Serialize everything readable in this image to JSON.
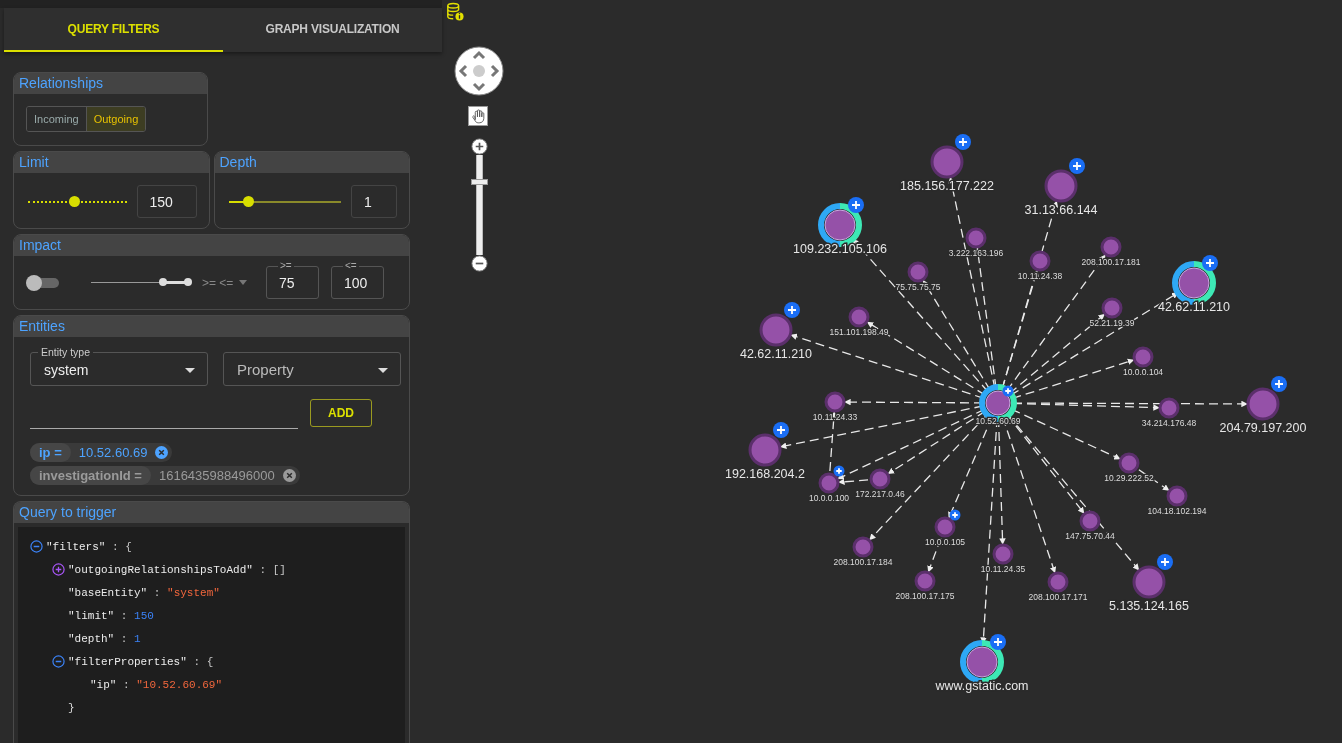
{
  "tabs": [
    {
      "label": "QUERY FILTERS",
      "selected": true
    },
    {
      "label": "GRAPH VISUALIZATION",
      "selected": false
    }
  ],
  "relationships": {
    "title": "Relationships",
    "options": [
      {
        "label": "Incoming",
        "selected": false
      },
      {
        "label": "Outgoing",
        "selected": true
      }
    ]
  },
  "limit": {
    "title": "Limit",
    "level": 0.48,
    "value": "150"
  },
  "depth": {
    "title": "Depth",
    "level": 0.18,
    "value": "1"
  },
  "impact": {
    "title": "Impact",
    "enabled": false,
    "range": [
      {
        "level": 0.74
      },
      {
        "level": 1
      }
    ],
    "operator": ">= <=",
    "min": {
      "label": ">=",
      "value": "75"
    },
    "max": {
      "label": "<=",
      "value": "100"
    }
  },
  "entities": {
    "title": "Entities",
    "entity_type": {
      "label": "Entity type",
      "value": "system"
    },
    "property": {
      "placeholder": "Property"
    },
    "add_button": "ADD",
    "chips": [
      {
        "key": "ip =",
        "value": "10.52.60.69",
        "color": "#4da3ff"
      },
      {
        "key": "investigationId =",
        "value": "1616435988496000",
        "color": "#9a9a9a"
      }
    ]
  },
  "query": {
    "title": "Query to trigger",
    "tree": [
      {
        "expanded": true,
        "parts": [
          {
            "text": "\"filters\"",
            "kind": "key"
          },
          {
            "text": " : {",
            "kind": "punct"
          }
        ],
        "children": [
          {
            "expanded": false,
            "parts": [
              {
                "text": "\"outgoingRelationshipsToAdd\"",
                "kind": "key"
              },
              {
                "text": " : []",
                "kind": "punct"
              }
            ]
          },
          {
            "parts": [
              {
                "text": "\"baseEntity\"",
                "kind": "key"
              },
              {
                "text": " : ",
                "kind": "punct"
              },
              {
                "text": "\"system\"",
                "kind": "string"
              }
            ]
          },
          {
            "parts": [
              {
                "text": "\"limit\"",
                "kind": "key"
              },
              {
                "text": " : ",
                "kind": "punct"
              },
              {
                "text": "150",
                "kind": "number"
              }
            ]
          },
          {
            "parts": [
              {
                "text": "\"depth\"",
                "kind": "key"
              },
              {
                "text": " : ",
                "kind": "punct"
              },
              {
                "text": "1",
                "kind": "number"
              }
            ]
          },
          {
            "expanded": true,
            "parts": [
              {
                "text": "\"filterProperties\"",
                "kind": "key"
              },
              {
                "text": " : {",
                "kind": "punct"
              }
            ],
            "closing": "}",
            "children": [
              {
                "parts": [
                  {
                    "text": "\"ip\"",
                    "kind": "key"
                  },
                  {
                    "text": " : ",
                    "kind": "punct"
                  },
                  {
                    "text": "\"10.52.60.69\"",
                    "kind": "string"
                  }
                ]
              }
            ]
          }
        ]
      }
    ]
  },
  "graph_controls": {
    "zoom": {
      "level": 0.73
    }
  },
  "graph": {
    "nodes": [
      {
        "label": "185.156.177.222",
        "kind": "large",
        "ring": false,
        "badge": true
      },
      {
        "label": "31.13.66.144",
        "kind": "large",
        "ring": false,
        "badge": true
      },
      {
        "label": "109.232.105.106",
        "kind": "large",
        "ring": true,
        "badge": true
      },
      {
        "label": "3.222.163.196",
        "kind": "small",
        "ring": false,
        "badge": false
      },
      {
        "label": "208.100.17.181",
        "kind": "small",
        "ring": false,
        "badge": false
      },
      {
        "label": "10.11.24.38",
        "kind": "small",
        "ring": false,
        "badge": false
      },
      {
        "label": "75.75.75.75",
        "kind": "small",
        "ring": false,
        "badge": false
      },
      {
        "label": "42.62.11.210",
        "kind": "large",
        "ring": true,
        "badge": true
      },
      {
        "label": "52.21.19.39",
        "kind": "small",
        "ring": false,
        "badge": false
      },
      {
        "label": "151.101.198.49",
        "kind": "small",
        "ring": false,
        "badge": false
      },
      {
        "label": "42.62.11.210",
        "kind": "large",
        "ring": false,
        "badge": true
      },
      {
        "label": "10.0.0.104",
        "kind": "small",
        "ring": false,
        "badge": false
      },
      {
        "label": "10.11.24.33",
        "kind": "small",
        "ring": false,
        "badge": false
      },
      {
        "label": "10.52.60.69",
        "kind": "hub",
        "ring": true,
        "badge": true
      },
      {
        "label": "204.79.197.200",
        "kind": "large",
        "ring": false,
        "badge": true
      },
      {
        "label": "34.214.176.48",
        "kind": "small",
        "ring": false,
        "badge": false
      },
      {
        "label": "192.168.204.2",
        "kind": "large",
        "ring": false,
        "badge": true
      },
      {
        "label": "10.29.222.52",
        "kind": "small",
        "ring": false,
        "badge": false
      },
      {
        "label": "172.217.0.46",
        "kind": "small",
        "ring": false,
        "badge": false
      },
      {
        "label": "10.0.0.100",
        "kind": "small",
        "ring": false,
        "badge": true
      },
      {
        "label": "104.18.102.194",
        "kind": "small",
        "ring": false,
        "badge": false
      },
      {
        "label": "147.75.70.44",
        "kind": "small",
        "ring": false,
        "badge": false
      },
      {
        "label": "10.0.0.105",
        "kind": "small",
        "ring": false,
        "badge": true
      },
      {
        "label": "208.100.17.184",
        "kind": "small",
        "ring": false,
        "badge": false
      },
      {
        "label": "10.11.24.35",
        "kind": "small",
        "ring": false,
        "badge": false
      },
      {
        "label": "208.100.17.175",
        "kind": "small",
        "ring": false,
        "badge": false
      },
      {
        "label": "208.100.17.171",
        "kind": "small",
        "ring": false,
        "badge": false
      },
      {
        "label": "5.135.124.165",
        "kind": "large",
        "ring": false,
        "badge": true
      },
      {
        "label": "www.gstatic.com",
        "kind": "large",
        "ring": true,
        "badge": true
      }
    ]
  }
}
